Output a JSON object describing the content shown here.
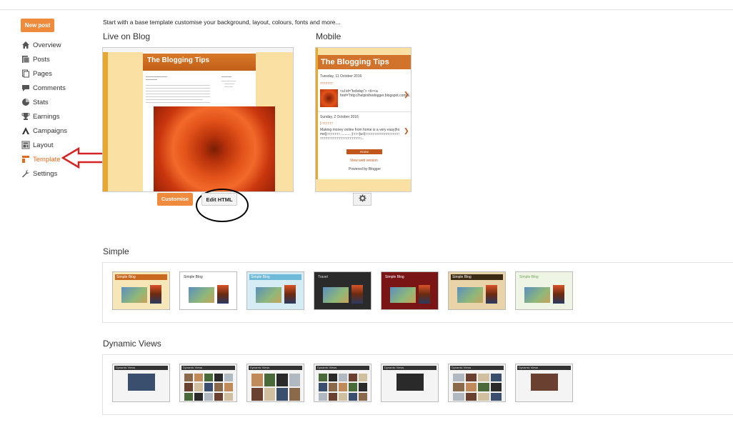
{
  "sidebar": {
    "new_post": "New post",
    "items": [
      {
        "label": "Overview",
        "icon": "home-icon"
      },
      {
        "label": "Posts",
        "icon": "posts-icon"
      },
      {
        "label": "Pages",
        "icon": "pages-icon"
      },
      {
        "label": "Comments",
        "icon": "comments-icon"
      },
      {
        "label": "Stats",
        "icon": "stats-icon"
      },
      {
        "label": "Earnings",
        "icon": "trophy-icon"
      },
      {
        "label": "Campaigns",
        "icon": "campaigns-icon"
      },
      {
        "label": "Layout",
        "icon": "layout-icon"
      },
      {
        "label": "Template",
        "icon": "template-icon",
        "active": true
      },
      {
        "label": "Settings",
        "icon": "wrench-icon"
      }
    ]
  },
  "intro": "Start with a base template customise your background, layout, colours, fonts and more...",
  "live": {
    "heading": "Live on Blog",
    "blog_title": "The Blogging Tips",
    "customise_label": "Customise",
    "edit_html_label": "Edit HTML"
  },
  "mobile": {
    "heading": "Mobile",
    "blog_title": "The Blogging Tips",
    "post1_date": "Tuesday, 11 October 2016",
    "post1_title": "□□□□□□",
    "post1_snippet": "<ul id=\"bcbdsp\"> <li><a href=\"http://helpinthedogger.blogspot.com/&...",
    "post2_date": "Sunday, 2 October 2016",
    "post2_title": "| □□□□□",
    "post2_snippet": "Making money online from home is a very easy|home||□□□□□□ .......... |□□□|a-l|□□□□□□□□□□□□□□□□□□□□□□□□□□□□□□□□□□□...",
    "home_label": "Home",
    "web_version": "View web version",
    "powered": "Powered by Blogger"
  },
  "simple": {
    "heading": "Simple",
    "templates": [
      {
        "label": "Simple Blog",
        "bg": "#f6e6b8",
        "hdr": "#c8691f",
        "fg": "#fff"
      },
      {
        "label": "Simple Blog",
        "bg": "#ffffff",
        "hdr": "#ffffff",
        "fg": "#333"
      },
      {
        "label": "Simple Blog",
        "bg": "#d6ecf5",
        "hdr": "#6fbad8",
        "fg": "#fff"
      },
      {
        "label": "Travel",
        "bg": "#2a2a2a",
        "hdr": "#2a2a2a",
        "fg": "#ddd"
      },
      {
        "label": "Simple Blog",
        "bg": "#7a1515",
        "hdr": "#7a1515",
        "fg": "#fff"
      },
      {
        "label": "Simple Blog",
        "bg": "#e8d4a8",
        "hdr": "#3b2a14",
        "fg": "#fff"
      },
      {
        "label": "Simple Blog",
        "bg": "#eef5e4",
        "hdr": "#eef5e4",
        "fg": "#6fa85a"
      }
    ]
  },
  "dynamic": {
    "heading": "Dynamic Views",
    "templates": [
      {
        "label": "Dynamic Views",
        "style": "classic"
      },
      {
        "label": "Dynamic Views",
        "style": "flipcard"
      },
      {
        "label": "Dynamic Views",
        "style": "magazine"
      },
      {
        "label": "Dynamic Views",
        "style": "mosaic"
      },
      {
        "label": "Dynamic Views",
        "style": "sidebar"
      },
      {
        "label": "Dynamic Views",
        "style": "snapshot"
      },
      {
        "label": "Dynamic Views",
        "style": "timeslide"
      }
    ]
  }
}
